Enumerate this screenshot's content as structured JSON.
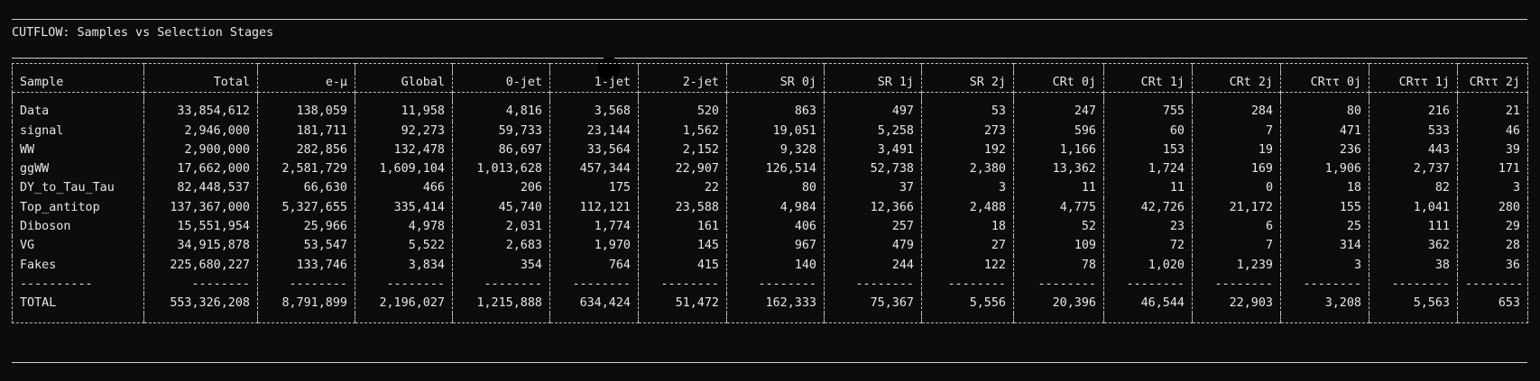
{
  "title": "CUTFLOW: Samples vs Selection Stages",
  "columns": [
    "Sample",
    "Total",
    "e-μ",
    "Global",
    "0-jet",
    "1-jet",
    "2-jet",
    "SR 0j",
    "SR 1j",
    "SR 2j",
    "CRt 0j",
    "CRt 1j",
    "CRt 2j",
    "CRττ 0j",
    "CRττ 1j",
    "CRττ 2j"
  ],
  "rows": [
    [
      "Data",
      "33,854,612",
      "138,059",
      "11,958",
      "4,816",
      "3,568",
      "520",
      "863",
      "497",
      "53",
      "247",
      "755",
      "284",
      "80",
      "216",
      "21"
    ],
    [
      "signal",
      "2,946,000",
      "181,711",
      "92,273",
      "59,733",
      "23,144",
      "1,562",
      "19,051",
      "5,258",
      "273",
      "596",
      "60",
      "7",
      "471",
      "533",
      "46"
    ],
    [
      "WW",
      "2,900,000",
      "282,856",
      "132,478",
      "86,697",
      "33,564",
      "2,152",
      "9,328",
      "3,491",
      "192",
      "1,166",
      "153",
      "19",
      "236",
      "443",
      "39"
    ],
    [
      "ggWW",
      "17,662,000",
      "2,581,729",
      "1,609,104",
      "1,013,628",
      "457,344",
      "22,907",
      "126,514",
      "52,738",
      "2,380",
      "13,362",
      "1,724",
      "169",
      "1,906",
      "2,737",
      "171"
    ],
    [
      "DY_to_Tau_Tau",
      "82,448,537",
      "66,630",
      "466",
      "206",
      "175",
      "22",
      "80",
      "37",
      "3",
      "11",
      "11",
      "0",
      "18",
      "82",
      "3"
    ],
    [
      "Top_antitop",
      "137,367,000",
      "5,327,655",
      "335,414",
      "45,740",
      "112,121",
      "23,588",
      "4,984",
      "12,366",
      "2,488",
      "4,775",
      "42,726",
      "21,172",
      "155",
      "1,041",
      "280"
    ],
    [
      "Diboson",
      "15,551,954",
      "25,966",
      "4,978",
      "2,031",
      "1,774",
      "161",
      "406",
      "257",
      "18",
      "52",
      "23",
      "6",
      "25",
      "111",
      "29"
    ],
    [
      "VG",
      "34,915,878",
      "53,547",
      "5,522",
      "2,683",
      "1,970",
      "145",
      "967",
      "479",
      "27",
      "109",
      "72",
      "7",
      "314",
      "362",
      "28"
    ],
    [
      "Fakes",
      "225,680,227",
      "133,746",
      "3,834",
      "354",
      "764",
      "415",
      "140",
      "244",
      "122",
      "78",
      "1,020",
      "1,239",
      "3",
      "38",
      "36"
    ]
  ],
  "separator_row": [
    "----------",
    "--------",
    "--------",
    "--------",
    "--------",
    "--------",
    "--------",
    "--------",
    "--------",
    "--------",
    "--------",
    "--------",
    "--------",
    "--------",
    "--------",
    "--------"
  ],
  "total_row": [
    "TOTAL",
    "553,326,208",
    "8,791,899",
    "2,196,027",
    "1,215,888",
    "634,424",
    "51,472",
    "162,333",
    "75,367",
    "5,556",
    "20,396",
    "46,544",
    "22,903",
    "3,208",
    "5,563",
    "653"
  ]
}
